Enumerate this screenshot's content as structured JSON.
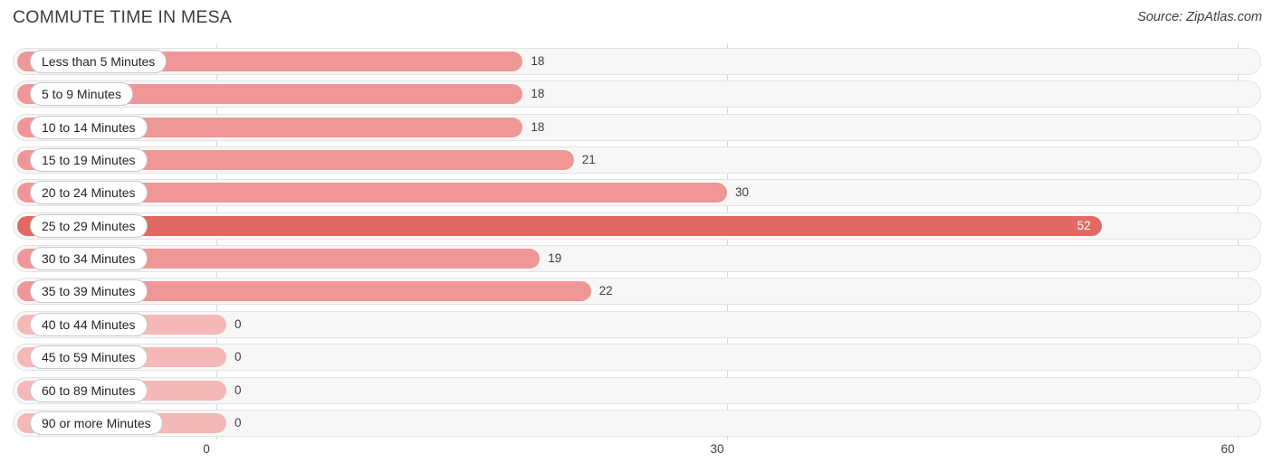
{
  "header": {
    "title": "COMMUTE TIME IN MESA",
    "source": "Source: ZipAtlas.com"
  },
  "colors": {
    "bar": "#ef9696",
    "bar_max": "#e06a62",
    "bar_zero": "#f4b8b8",
    "track": "#f7f7f7",
    "track_border": "#e3e3e3",
    "gridline": "#d8d8d8",
    "text": "#3c3c46"
  },
  "chart_data": {
    "type": "bar",
    "orientation": "horizontal",
    "title": "COMMUTE TIME IN MESA",
    "xlabel": "",
    "ylabel": "",
    "xlim": [
      0,
      60
    ],
    "grid": true,
    "legend": "none",
    "xticks": [
      "0",
      "30",
      "60"
    ],
    "xtick_values": [
      0,
      30,
      60
    ],
    "categories": [
      "Less than 5 Minutes",
      "5 to 9 Minutes",
      "10 to 14 Minutes",
      "15 to 19 Minutes",
      "20 to 24 Minutes",
      "25 to 29 Minutes",
      "30 to 34 Minutes",
      "35 to 39 Minutes",
      "40 to 44 Minutes",
      "45 to 59 Minutes",
      "60 to 89 Minutes",
      "90 or more Minutes"
    ],
    "values": [
      18,
      18,
      18,
      21,
      30,
      52,
      19,
      22,
      0,
      0,
      0,
      0
    ],
    "value_labels": [
      "18",
      "18",
      "18",
      "21",
      "30",
      "52",
      "19",
      "22",
      "0",
      "0",
      "0",
      "0"
    ]
  },
  "rows": [
    {
      "label": "Less than 5 Minutes",
      "value": 18,
      "value_label": "18",
      "style": "normal"
    },
    {
      "label": "5 to 9 Minutes",
      "value": 18,
      "value_label": "18",
      "style": "normal"
    },
    {
      "label": "10 to 14 Minutes",
      "value": 18,
      "value_label": "18",
      "style": "normal"
    },
    {
      "label": "15 to 19 Minutes",
      "value": 21,
      "value_label": "21",
      "style": "normal"
    },
    {
      "label": "20 to 24 Minutes",
      "value": 30,
      "value_label": "30",
      "style": "normal"
    },
    {
      "label": "25 to 29 Minutes",
      "value": 52,
      "value_label": "52",
      "style": "max"
    },
    {
      "label": "30 to 34 Minutes",
      "value": 19,
      "value_label": "19",
      "style": "normal"
    },
    {
      "label": "35 to 39 Minutes",
      "value": 22,
      "value_label": "22",
      "style": "normal"
    },
    {
      "label": "40 to 44 Minutes",
      "value": 0,
      "value_label": "0",
      "style": "zero"
    },
    {
      "label": "45 to 59 Minutes",
      "value": 0,
      "value_label": "0",
      "style": "zero"
    },
    {
      "label": "60 to 89 Minutes",
      "value": 0,
      "value_label": "0",
      "style": "zero"
    },
    {
      "label": "90 or more Minutes",
      "value": 0,
      "value_label": "0",
      "style": "zero"
    }
  ],
  "axis": {
    "ticks": [
      {
        "label": "0",
        "value": 0
      },
      {
        "label": "30",
        "value": 30
      },
      {
        "label": "60",
        "value": 60
      }
    ]
  }
}
